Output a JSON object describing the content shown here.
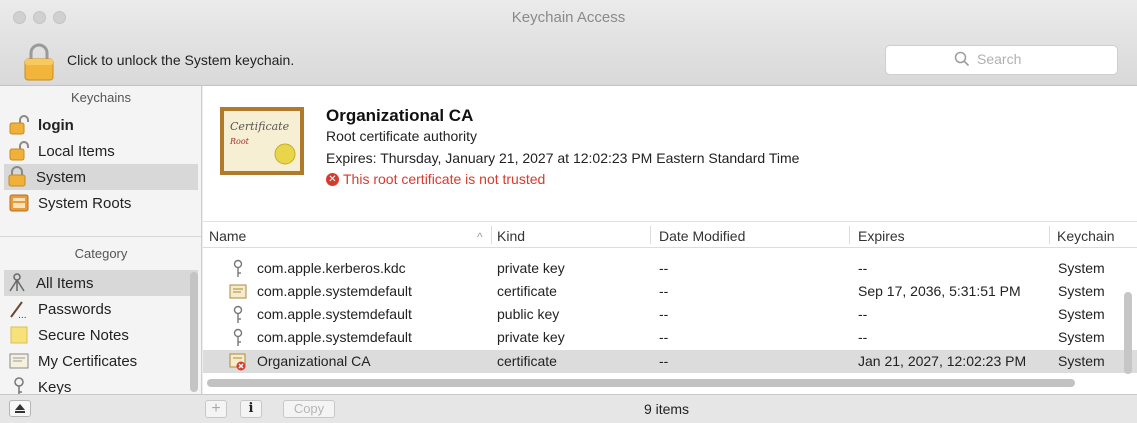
{
  "window": {
    "title": "Keychain Access"
  },
  "toolbar": {
    "lock_message": "Click to unlock the System keychain.",
    "search_placeholder": "Search"
  },
  "sidebar": {
    "keychains_header": "Keychains",
    "keychains": [
      {
        "label": "login",
        "icon": "lock-open-icon",
        "bold": true
      },
      {
        "label": "Local Items",
        "icon": "lock-open-icon"
      },
      {
        "label": "System",
        "icon": "lock-closed-icon",
        "selected": true
      },
      {
        "label": "System Roots",
        "icon": "cabinet-icon"
      }
    ],
    "category_header": "Category",
    "categories": [
      {
        "label": "All Items",
        "icon": "all-items-icon",
        "selected": true
      },
      {
        "label": "Passwords",
        "icon": "password-icon"
      },
      {
        "label": "Secure Notes",
        "icon": "note-icon"
      },
      {
        "label": "My Certificates",
        "icon": "certificate-icon"
      },
      {
        "label": "Keys",
        "icon": "key-icon"
      }
    ]
  },
  "detail": {
    "image_text_1": "Certificate",
    "image_text_2": "Root",
    "name": "Organizational CA",
    "subtitle": "Root certificate authority",
    "expires": "Expires: Thursday, January 21, 2027 at 12:02:23 PM Eastern Standard Time",
    "warning": "This root certificate is not trusted",
    "warning_color": "#d63b2c"
  },
  "table": {
    "columns": [
      "Name",
      "Kind",
      "Date Modified",
      "Expires",
      "Keychain"
    ],
    "rows": [
      {
        "icon": "key-icon",
        "name": "com.apple.kerberos.kdc",
        "kind": "private key",
        "modified": "--",
        "expires": "--",
        "keychain": "System"
      },
      {
        "icon": "certificate-icon",
        "name": "com.apple.systemdefault",
        "kind": "certificate",
        "modified": "--",
        "expires": "Sep 17, 2036, 5:31:51 PM",
        "keychain": "System"
      },
      {
        "icon": "key-icon",
        "name": "com.apple.systemdefault",
        "kind": "public key",
        "modified": "--",
        "expires": "--",
        "keychain": "System"
      },
      {
        "icon": "key-icon",
        "name": "com.apple.systemdefault",
        "kind": "private key",
        "modified": "--",
        "expires": "--",
        "keychain": "System"
      },
      {
        "icon": "untrusted-certificate-icon",
        "name": "Organizational CA",
        "kind": "certificate",
        "modified": "--",
        "expires": "Jan 21, 2027, 12:02:23 PM",
        "keychain": "System",
        "selected": true
      }
    ]
  },
  "bottombar": {
    "add_label": "+",
    "info_label": "i",
    "copy_label": "Copy",
    "item_count": "9 items"
  }
}
